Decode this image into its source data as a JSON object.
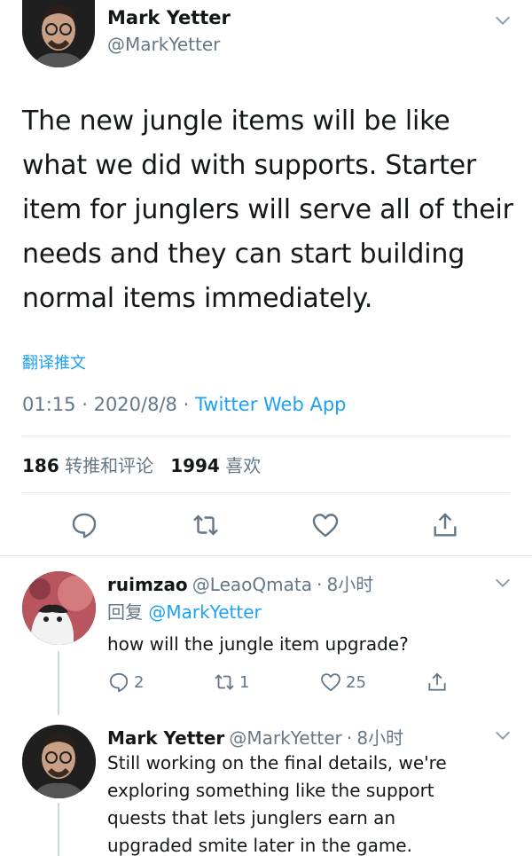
{
  "main_tweet": {
    "author_name": "Mark Yetter",
    "author_handle": "@MarkYetter",
    "text_lines": [
      "The new jungle items will be like",
      "what we did with supports. Starter",
      "item for junglers will serve all of their",
      "needs and they can start building",
      "normal items immediately."
    ],
    "translate_label": "翻译推文",
    "time": "01:15",
    "date": "2020/8/8",
    "source": "Twitter Web App",
    "retweet_count": "186",
    "retweet_label": "转推和评论",
    "like_count": "1994",
    "like_label": "喜欢",
    "icons": [
      "reply-icon",
      "retweet-icon",
      "like-icon",
      "share-icon"
    ]
  },
  "reply_1": {
    "author_name": "ruimzao",
    "author_handle": "@LeaoQmata",
    "time_ago": "8小时",
    "reply_prefix": "回复",
    "reply_to": "@MarkYetter",
    "text": "how will the jungle item upgrade?",
    "reply_count": "2",
    "retweet_count": "1",
    "like_count": "25"
  },
  "reply_2": {
    "author_name": "Mark Yetter",
    "author_handle": "@MarkYetter",
    "time_ago": "8小时",
    "text_lines": [
      "Still working on the final details, we're",
      "exploring something like the support",
      "quests that lets junglers earn an",
      "upgraded smite later in the game."
    ]
  },
  "colors": {
    "text": "#14171a",
    "secondary": "#657786",
    "accent": "#1da1f2",
    "divider": "#e1e8ed"
  }
}
